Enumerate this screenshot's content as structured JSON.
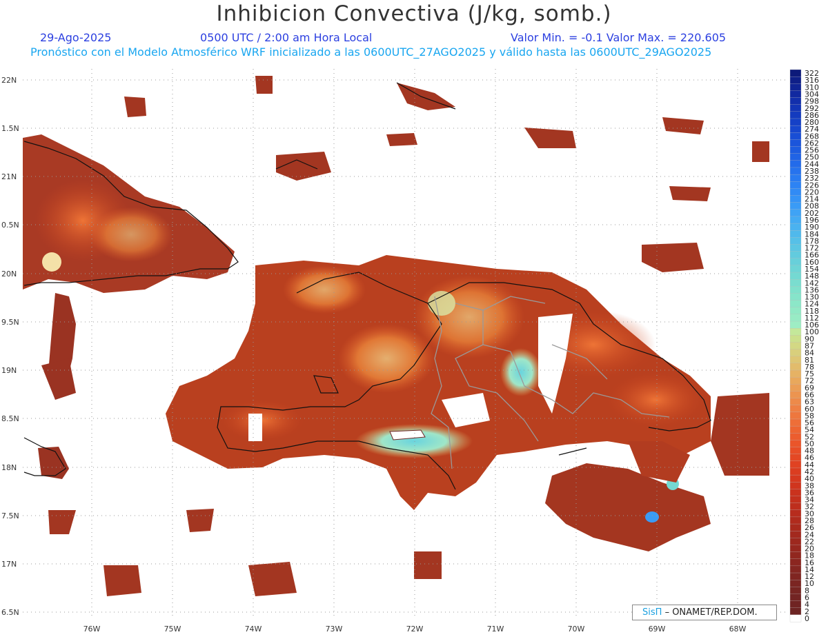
{
  "title": "Inhibicion Convectiva (J/kg, somb.)",
  "header": {
    "date": "29-Ago-2025",
    "time": "0500 UTC / 2:00 am Hora Local",
    "minmax": "Valor Min. = -0.1  Valor Max. = 220.605",
    "model_line": "Pronóstico con el Modelo Atmosférico WRF inicializado a las 0600UTC_27AGO2025 y válido hasta las  0600UTC_29AGO2025"
  },
  "lat_labels": [
    "22N",
    "1.5N",
    "21N",
    "0.5N",
    "20N",
    "9.5N",
    "19N",
    "8.5N",
    "18N",
    "7.5N",
    "17N",
    "6.5N"
  ],
  "lon_labels": [
    "76W",
    "75W",
    "74W",
    "73W",
    "72W",
    "71W",
    "70W",
    "69W",
    "68W"
  ],
  "colorbar": {
    "labels": [
      "322",
      "316",
      "310",
      "304",
      "298",
      "292",
      "286",
      "280",
      "274",
      "268",
      "262",
      "256",
      "250",
      "244",
      "238",
      "232",
      "226",
      "220",
      "214",
      "208",
      "202",
      "196",
      "190",
      "184",
      "178",
      "172",
      "166",
      "160",
      "154",
      "148",
      "142",
      "136",
      "130",
      "124",
      "118",
      "112",
      "106",
      "100",
      "90",
      "87",
      "84",
      "81",
      "78",
      "75",
      "72",
      "69",
      "66",
      "63",
      "60",
      "58",
      "56",
      "54",
      "52",
      "50",
      "48",
      "46",
      "44",
      "42",
      "40",
      "38",
      "36",
      "34",
      "32",
      "30",
      "28",
      "26",
      "24",
      "22",
      "20",
      "18",
      "16",
      "14",
      "12",
      "10",
      "8",
      "6",
      "4",
      "2",
      "0"
    ],
    "colors": [
      "#0d1a7a",
      "#0f1f88",
      "#102494",
      "#1129a0",
      "#122fac",
      "#1335b6",
      "#143bbf",
      "#1541c7",
      "#1747ce",
      "#194ed5",
      "#1b55db",
      "#1d5ce0",
      "#2063e5",
      "#236bea",
      "#2673ee",
      "#297bf1",
      "#2d83f4",
      "#318bf5",
      "#3593f6",
      "#3a9bf6",
      "#3fa3f5",
      "#44abf3",
      "#4ab2f0",
      "#50b9ec",
      "#56c0e8",
      "#5cc6e3",
      "#62cbde",
      "#68d0da",
      "#6ed5d6",
      "#74d9d2",
      "#7addcf",
      "#80e1cc",
      "#86e4ca",
      "#8ce7c8",
      "#92e9c6",
      "#98ebc5",
      "#9eedc4",
      "#c4e89a",
      "#cce08c",
      "#d3d884",
      "#d9cf7c",
      "#dec674",
      "#e2bc6c",
      "#e6b264",
      "#e9a85c",
      "#eb9e56",
      "#ec9450",
      "#ed8a4a",
      "#ee8044",
      "#ee773e",
      "#ee6e38",
      "#ed6532",
      "#ec5d2e",
      "#ea552a",
      "#e74e27",
      "#e44824",
      "#e04222",
      "#db3d20",
      "#d6391f",
      "#d0351e",
      "#ca321d",
      "#c4301d",
      "#be2e1d",
      "#b72c1d",
      "#b02b1d",
      "#a92a1d",
      "#a3291e",
      "#9d281e",
      "#97271f",
      "#91271f",
      "#8b2620",
      "#852621",
      "#802521",
      "#7b2522",
      "#772522",
      "#732423",
      "#702423",
      "#6d2423",
      "#ffffff"
    ]
  },
  "credit": {
    "logo": "SisΠ",
    "text": "– ONAMET/REP.DOM."
  }
}
